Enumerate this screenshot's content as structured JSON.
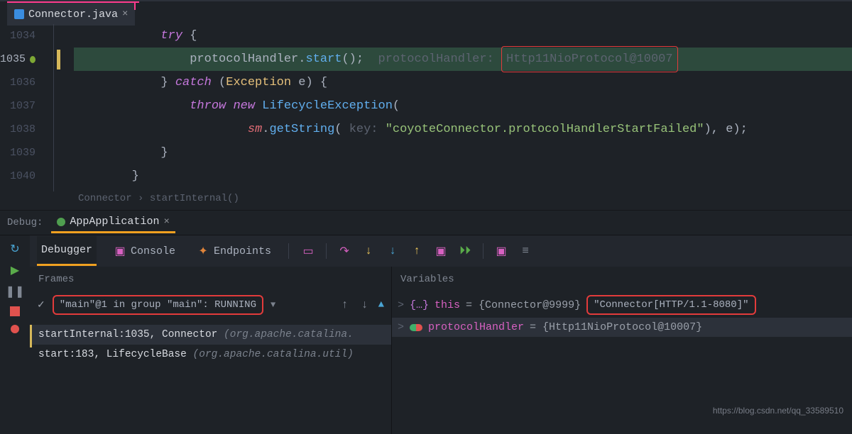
{
  "file": {
    "name": "Connector.java"
  },
  "editor": {
    "lines": [
      {
        "num": "1034",
        "indent": "            ",
        "tokens": [
          {
            "t": "try ",
            "c": "kw"
          },
          {
            "t": "{",
            "c": "pn"
          }
        ]
      },
      {
        "num": "1035",
        "current": true,
        "hl": true,
        "indent": "                ",
        "tokens": [
          {
            "t": "protocolHandler",
            "c": "pn"
          },
          {
            "t": ".",
            "c": "pn"
          },
          {
            "t": "start",
            "c": "mth"
          },
          {
            "t": "();",
            "c": "pn"
          },
          {
            "t": "  protocolHandler: ",
            "c": "hint"
          }
        ],
        "boxText": "Http11NioProtocol@10007"
      },
      {
        "num": "1036",
        "indent": "            ",
        "tokens": [
          {
            "t": "} ",
            "c": "pn"
          },
          {
            "t": "catch ",
            "c": "kw"
          },
          {
            "t": "(",
            "c": "pn"
          },
          {
            "t": "Exception ",
            "c": "cls"
          },
          {
            "t": "e",
            "c": "pn"
          },
          {
            "t": ") {",
            "c": "pn"
          }
        ]
      },
      {
        "num": "1037",
        "indent": "                ",
        "tokens": [
          {
            "t": "throw new ",
            "c": "kw"
          },
          {
            "t": "LifecycleException",
            "c": "mth"
          },
          {
            "t": "(",
            "c": "pn"
          }
        ]
      },
      {
        "num": "1038",
        "indent": "                        ",
        "tokens": [
          {
            "t": "sm",
            "c": "sm"
          },
          {
            "t": ".",
            "c": "pn"
          },
          {
            "t": "getString",
            "c": "mth"
          },
          {
            "t": "( ",
            "c": "pn"
          },
          {
            "t": "key: ",
            "c": "hint"
          },
          {
            "t": "\"coyoteConnector.protocolHandlerStartFailed\"",
            "c": "str"
          },
          {
            "t": "), ",
            "c": "pn"
          },
          {
            "t": "e",
            "c": "pn"
          },
          {
            "t": ");",
            "c": "pn"
          }
        ]
      },
      {
        "num": "1039",
        "indent": "            ",
        "tokens": [
          {
            "t": "}",
            "c": "pn"
          }
        ]
      },
      {
        "num": "1040",
        "indent": "        ",
        "tokens": [
          {
            "t": "}",
            "c": "pn"
          }
        ]
      }
    ]
  },
  "breadcrumb": {
    "class": "Connector",
    "sep": " › ",
    "method": "startInternal()"
  },
  "debug": {
    "label": "Debug:",
    "config": "AppApplication",
    "tabs": {
      "debugger": "Debugger",
      "console": "Console",
      "endpoints": "Endpoints"
    }
  },
  "frames": {
    "title": "Frames",
    "thread": "\"main\"@1 in group \"main\": RUNNING",
    "items": [
      {
        "sel": true,
        "text": "startInternal:1035, Connector ",
        "pkg": "(org.apache.catalina."
      },
      {
        "sel": false,
        "text": "start:183, LifecycleBase ",
        "pkg": "(org.apache.catalina.util)"
      }
    ]
  },
  "variables": {
    "title": "Variables",
    "this": {
      "arrow": ">",
      "name": "this",
      "value": " = {Connector@9999} ",
      "box": "\"Connector[HTTP/1.1-8080]\""
    },
    "proto": {
      "arrow": ">",
      "name": "protocolHandler",
      "value": " = {Http11NioProtocol@10007}"
    }
  },
  "watermark": "https://blog.csdn.net/qq_33589510"
}
